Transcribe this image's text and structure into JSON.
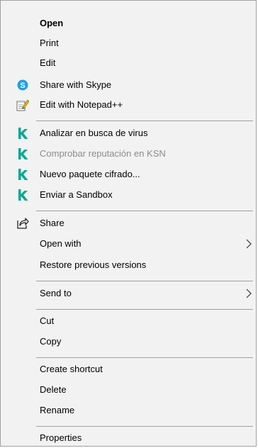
{
  "menu": {
    "items": [
      {
        "label": "Open"
      },
      {
        "label": "Print"
      },
      {
        "label": "Edit"
      },
      {
        "label": "Share with Skype",
        "icon": "skype-icon"
      },
      {
        "label": "Edit with Notepad++",
        "icon": "notepad-plus-plus-icon"
      },
      {
        "label": "Analizar en busca de virus",
        "icon": "kaspersky-k-icon"
      },
      {
        "label": "Comprobar reputación en KSN",
        "icon": "kaspersky-k-icon",
        "disabled": true
      },
      {
        "label": "Nuevo paquete cifrado...",
        "icon": "kaspersky-k-icon"
      },
      {
        "label": "Enviar a Sandbox",
        "icon": "kaspersky-k-icon"
      },
      {
        "label": "Share",
        "icon": "share-icon"
      },
      {
        "label": "Open with",
        "submenu": true
      },
      {
        "label": "Restore previous versions"
      },
      {
        "label": "Send to",
        "submenu": true
      },
      {
        "label": "Cut"
      },
      {
        "label": "Copy"
      },
      {
        "label": "Create shortcut"
      },
      {
        "label": "Delete"
      },
      {
        "label": "Rename"
      },
      {
        "label": "Properties"
      }
    ]
  },
  "colors": {
    "menu_background": "#f2f2f2",
    "separator": "#a0a0a0",
    "kaspersky": "#00a88e",
    "skype": "#1fa0e4",
    "disabled_text": "#8c8c8c"
  }
}
